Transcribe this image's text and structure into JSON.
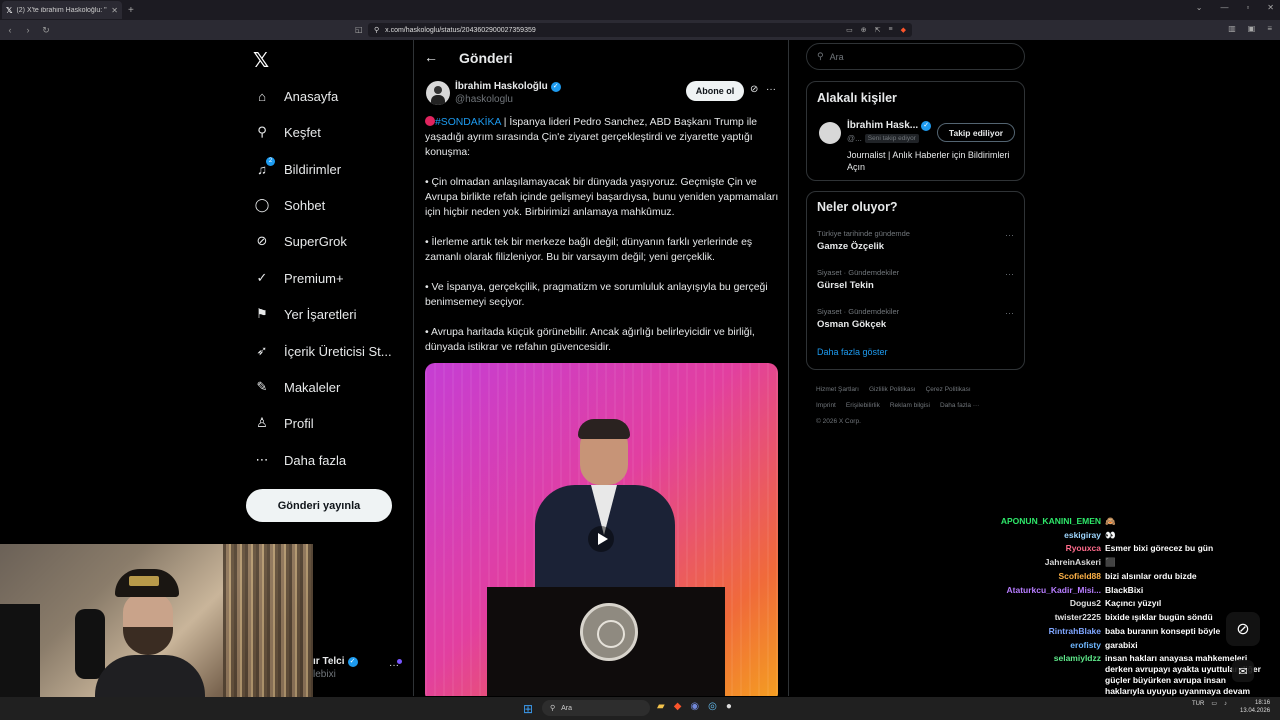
{
  "browser": {
    "tab_title": "(2) X'te ibrahim Haskoloğlu: \"",
    "url": "x.com/haskologlu/status/2043602900027359359"
  },
  "nav": {
    "items": [
      {
        "label": "Anasayfa",
        "icon": "home-icon"
      },
      {
        "label": "Keşfet",
        "icon": "search-icon"
      },
      {
        "label": "Bildirimler",
        "icon": "bell-icon",
        "badge": "2"
      },
      {
        "label": "Sohbet",
        "icon": "chat-icon"
      },
      {
        "label": "SuperGrok",
        "icon": "grok-icon"
      },
      {
        "label": "Premium+",
        "icon": "premium-icon"
      },
      {
        "label": "Yer İşaretleri",
        "icon": "bookmark-icon"
      },
      {
        "label": "İçerik Üreticisi St...",
        "icon": "rocket-icon"
      },
      {
        "label": "Makaleler",
        "icon": "article-icon"
      },
      {
        "label": "Profil",
        "icon": "user-icon"
      },
      {
        "label": "Daha fazla",
        "icon": "more-circle-icon"
      }
    ],
    "post_button": "Gönderi yayınla"
  },
  "account": {
    "name": "ır Telci",
    "handle": "lebixi"
  },
  "post": {
    "header": "Gönderi",
    "author_name": "İbrahim Haskoloğlu",
    "author_handle": "@haskologlu",
    "subscribe": "Abone ol",
    "hashtag": "#SONDAKİKA",
    "intro": " | İspanya lideri Pedro Sanchez, ABD Başkanı Trump ile yaşadığı ayrım sırasında Çin'e ziyaret gerçekleştirdi ve ziyarette yaptığı konuşma:",
    "p1": "• Çin olmadan anlaşılamayacak bir dünyada yaşıyoruz. Geçmişte Çin ve Avrupa birlikte refah içinde gelişmeyi başardıysa, bunu yeniden yapmamaları için hiçbir neden yok. Birbirimizi anlamaya mahkûmuz.",
    "p2": "• İlerleme artık tek bir merkeze bağlı değil; dünyanın farklı yerlerinde eş zamanlı olarak filizleniyor. Bu bir varsayım değil; yeni gerçeklik.",
    "p3": "• Ve İspanya, gerçekçilik, pragmatizm ve sorumluluk anlayışıyla bu gerçeği benimsemeyi seçiyor.",
    "p4": "• Avrupa haritada küçük görünebilir. Ancak ağırlığı belirleyicidir ve birliği, dünyada istikrar ve refahın güvencesidir."
  },
  "search": {
    "placeholder": "Ara"
  },
  "related": {
    "title": "Alakalı kişiler",
    "name": "İbrahim Hask...",
    "handle": "@...",
    "follows_you": "Seni takip ediyor",
    "follow_button": "Takip ediliyor",
    "bio": "Journalist | Anlık Haberler için Bildirimleri Açın"
  },
  "trends": {
    "title": "Neler oluyor?",
    "items": [
      {
        "category": "Türkiye tarihinde gündemde",
        "name": "Gamze Özçelik"
      },
      {
        "category": "Siyaset · Gündemdekiler",
        "name": "Gürsel Tekin"
      },
      {
        "category": "Siyaset · Gündemdekiler",
        "name": "Osman Gökçek"
      }
    ],
    "show_more": "Daha fazla göster"
  },
  "footer": {
    "links": [
      "Hizmet Şartları",
      "Gizlilik Politikası",
      "Çerez Politikası",
      "Imprint",
      "Erişilebilirlik",
      "Reklam bilgisi",
      "Daha fazla ···"
    ],
    "copyright": "© 2026 X Corp."
  },
  "chat": [
    {
      "user": "APONUN_KANINI_EMEN",
      "color": "#2ee86a",
      "msg": "🙈"
    },
    {
      "user": "eskigiray",
      "color": "#9fd7ff",
      "msg": "👀"
    },
    {
      "user": "Ryouxca",
      "color": "#ff6b8b",
      "msg": "Esmer bixi görecez bu gün"
    },
    {
      "user": "JahreinAskeri",
      "color": "#d9d9d9",
      "msg": "⬛"
    },
    {
      "user": "Scofield88",
      "color": "#ffb347",
      "msg": "bizi alsınlar ordu bizde"
    },
    {
      "user": "Ataturkcu_Kadir_Misi...",
      "color": "#b77dff",
      "msg": "BlackBixi"
    },
    {
      "user": "Dogus2",
      "color": "#e0e0e0",
      "msg": "Kaçıncı yüzyıl"
    },
    {
      "user": "twister2225",
      "color": "#e0e0e0",
      "msg": "bixide ışıklar bugün söndü"
    },
    {
      "user": "RintrahBlake",
      "color": "#7fa6ff",
      "msg": "baba buranın konsepti böyle"
    },
    {
      "user": "erofisty",
      "color": "#6fb7ff",
      "msg": "garabixi"
    },
    {
      "user": "selamiyldzz",
      "color": "#5ee88a",
      "msg": "insan hakları anayasa mahkemeleri derken avrupayı ayakta uyuttular diğer güçler büyürken avrupa insan haklarıyla uyuyup uyanmaya devam etsin @purplebixi"
    }
  ],
  "taskbar": {
    "search": "Ara",
    "lang": "TUR",
    "time": "18:16",
    "date": "13.04.2026"
  },
  "colors": {
    "accent": "#1d9bf0",
    "background": "#000000",
    "border": "#2f3336"
  }
}
